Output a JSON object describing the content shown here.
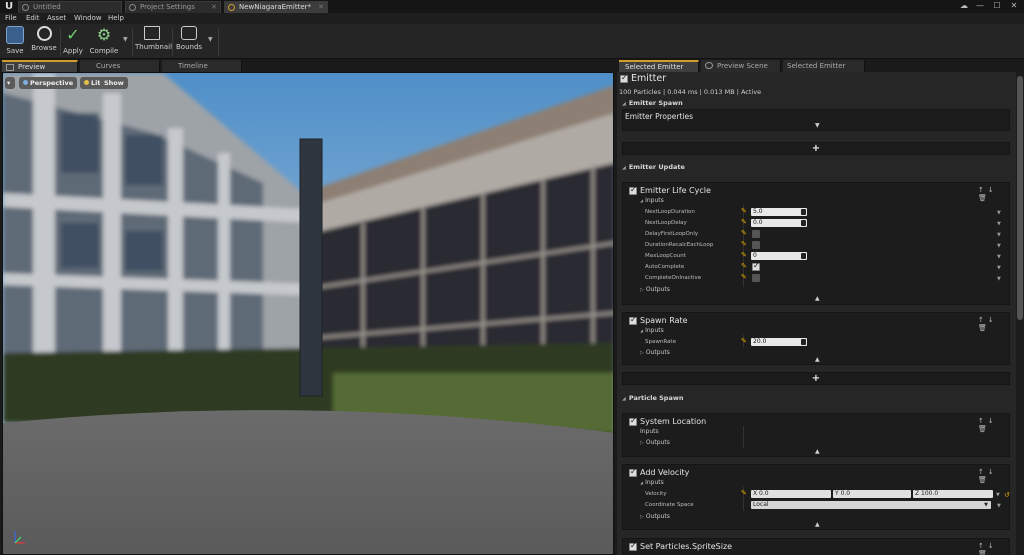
{
  "window": {
    "logo": "U",
    "tabs": [
      {
        "label": "Untitled"
      },
      {
        "label": "Project Settings"
      },
      {
        "label": "NewNiagaraEmitter*"
      }
    ],
    "controls": {
      "minimize": "—",
      "maximize": "☐",
      "close": "✕"
    }
  },
  "menu": [
    "File",
    "Edit",
    "Asset",
    "Window",
    "Help"
  ],
  "toolbar": {
    "save": "Save",
    "browse": "Browse",
    "apply": "Apply",
    "compile": "Compile",
    "thumbnail": "Thumbnail",
    "bounds": "Bounds"
  },
  "left_tabs": [
    "Preview",
    "Curves",
    "Timeline"
  ],
  "viewport": {
    "menu_icon": "▾",
    "perspective": "Perspective",
    "lit": "Lit",
    "show": "Show"
  },
  "right_tabs": [
    "Selected Emitter",
    "Preview Scene Sett",
    "Selected Emitter Grapl"
  ],
  "emitter": {
    "name": "Emitter",
    "stats": "100 Particles | 0.044 ms | 0.013 MB | Active",
    "spawn_section": "Emitter Spawn",
    "emitter_properties": "Emitter Properties",
    "update_section": "Emitter Update",
    "particle_spawn_section": "Particle Spawn"
  },
  "life_cycle": {
    "title": "Emitter Life Cycle",
    "inputs": "Inputs",
    "outputs": "Outputs",
    "params": [
      {
        "label": "NextLoopDuration",
        "value": "5.0"
      },
      {
        "label": "NextLoopDelay",
        "value": "0.0"
      },
      {
        "label": "DelayFirstLoopOnly",
        "value": ""
      },
      {
        "label": "DurationRecalcEachLoop",
        "value": ""
      },
      {
        "label": "MaxLoopCount",
        "value": "0"
      },
      {
        "label": "AutoComplete",
        "value": ""
      },
      {
        "label": "CompleteOnInactive",
        "value": ""
      }
    ]
  },
  "spawn_rate": {
    "title": "Spawn Rate",
    "inputs": "Inputs",
    "param_label": "SpawnRate",
    "param_value": "20.0",
    "outputs": "Outputs"
  },
  "system_location": {
    "title": "System Location",
    "inputs": "Inputs",
    "outputs": "Outputs"
  },
  "add_velocity": {
    "title": "Add Velocity",
    "inputs": "Inputs",
    "velocity_label": "Velocity",
    "x": "X 0.0",
    "y": "Y 0.0",
    "z": "Z 100.0",
    "coord_label": "Coordinate Space",
    "coord_value": "Local",
    "outputs": "Outputs"
  },
  "sprite_size": {
    "title": "Set Particles.SpriteSize"
  },
  "colors": {
    "accent": "#d09c2c",
    "pencil": "#e0a800"
  }
}
